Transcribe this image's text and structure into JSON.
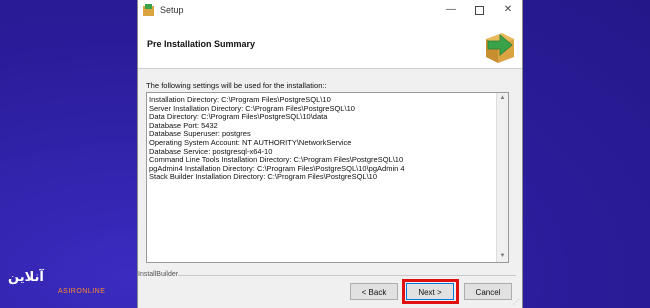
{
  "window": {
    "title": "Setup",
    "controls": {
      "minimize": "—",
      "maximize": "",
      "close": "✕"
    }
  },
  "header": {
    "title": "Pre Installation Summary",
    "icon": "install-arrow-box-icon"
  },
  "main": {
    "intro": "The following settings will be used for the installation::",
    "summary_lines": [
      "Installation Directory: C:\\Program Files\\PostgreSQL\\10",
      "Server Installation Directory: C:\\Program Files\\PostgreSQL\\10",
      "Data Directory: C:\\Program Files\\PostgreSQL\\10\\data",
      "Database Port: 5432",
      "Database Superuser: postgres",
      "Operating System Account: NT AUTHORITY\\NetworkService",
      "Database Service: postgresql-x64-10",
      "Command Line Tools Installation Directory: C:\\Program Files\\PostgreSQL\\10",
      "pgAdmin4 Installation Directory: C:\\Program Files\\PostgreSQL\\10\\pgAdmin 4",
      "Stack Builder Installation Directory: C:\\Program Files\\PostgreSQL\\10"
    ]
  },
  "footer": {
    "brand": "InstallBuilder",
    "back_label": "< Back",
    "next_label": "Next >",
    "cancel_label": "Cancel"
  },
  "overlay": {
    "logo_text": "آنلاین",
    "logo_sub": "ASIRONLINE"
  },
  "colors": {
    "background": "#2e1fa0",
    "highlight": "#e01010",
    "icon_green": "#3aa34a",
    "icon_box": "#d9a441"
  }
}
